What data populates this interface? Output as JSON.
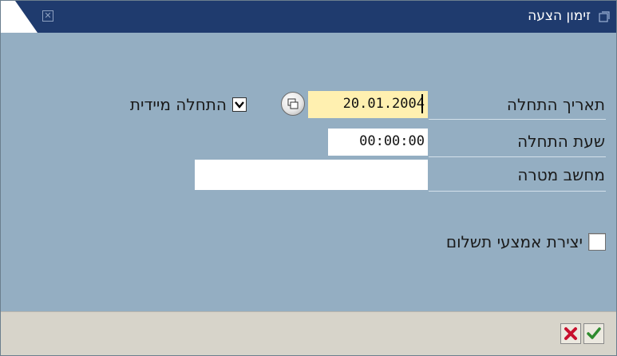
{
  "window": {
    "title": "זימון הצעה",
    "close_icon": "close-icon"
  },
  "form": {
    "start_date": {
      "label": "תאריך התחלה",
      "value": "20.01.2004"
    },
    "start_time": {
      "label": "שעת התחלה",
      "value": "00:00:00"
    },
    "target_computer": {
      "label": "מחשב מטרה",
      "value": ""
    },
    "immediate_start": {
      "label": "התחלה מיידית",
      "checked": true
    },
    "create_payment_means": {
      "label": "יצירת אמצעי תשלום",
      "checked": false
    }
  },
  "buttons": {
    "cancel_icon": "cancel-icon",
    "confirm_icon": "confirm-icon"
  },
  "colors": {
    "background": "#94aec2",
    "title_bar": "#1f3b6e",
    "active_field": "#fff0b0",
    "bottom_bar": "#d7d4ca",
    "cancel": "#c8102e",
    "confirm": "#2e8b2e"
  }
}
